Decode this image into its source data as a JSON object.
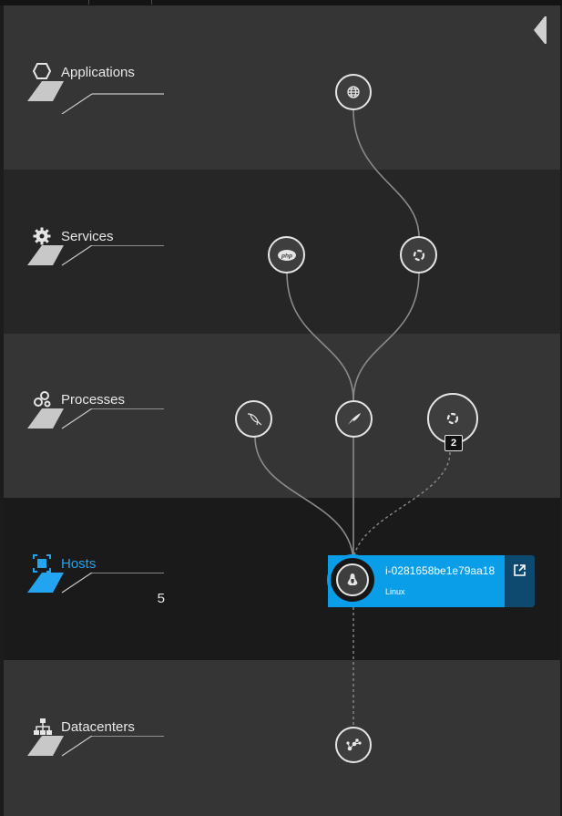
{
  "layers": {
    "applications": {
      "label": "Applications"
    },
    "services": {
      "label": "Services"
    },
    "processes": {
      "label": "Processes"
    },
    "hosts": {
      "label": "Hosts",
      "count": "5"
    },
    "datacenters": {
      "label": "Datacenters"
    }
  },
  "nodes": {
    "application": {
      "icon": "globe-icon"
    },
    "service_php": {
      "icon": "php-icon",
      "text": "php"
    },
    "service_generic": {
      "icon": "service-ring-icon"
    },
    "process_mysql": {
      "icon": "mysql-dolphin-icon"
    },
    "process_apache": {
      "icon": "apache-feather-icon"
    },
    "process_group": {
      "icon": "process-ring-icon",
      "badge": "2"
    },
    "host": {
      "icon": "linux-tux-icon"
    },
    "datacenter": {
      "icon": "datacenter-network-icon"
    }
  },
  "host_card": {
    "name": "i-0281658be1e79aa18",
    "os": "Linux"
  },
  "colors": {
    "accent": "#0a9ee8",
    "accent_dark": "#0e4a70",
    "band_light": "#353535",
    "band_mid": "#262626",
    "band_dark": "#1a1a1a",
    "node_border": "#e5e5e5",
    "edge": "#8a8a8a"
  }
}
